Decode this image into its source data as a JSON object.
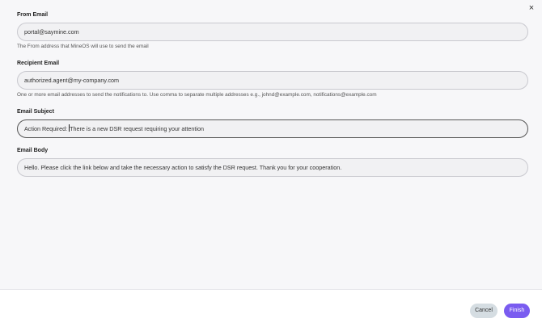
{
  "dialog": {
    "close_icon": "×"
  },
  "from_email": {
    "label": "From Email",
    "value": "portal@saymine.com",
    "help": "The From address that MineOS will use to send the email"
  },
  "recipient_email": {
    "label": "Recipient Email",
    "value": "authorized.agent@my-company.com",
    "help": "One or more email addresses to send the notifications to. Use comma to separate multiple addresses e.g., johnd@example.com, notifications@example.com"
  },
  "email_subject": {
    "label": "Email Subject",
    "value_before_caret": "Action Required: ",
    "value_after_caret": "There is a new DSR request requiring your attention"
  },
  "email_body": {
    "label": "Email Body",
    "value": "Hello.  Please click the link below and take the necessary action to satisfy the DSR request. Thank you for your cooperation."
  },
  "footer": {
    "cancel_label": "Cancel",
    "finish_label": "Finish"
  },
  "colors": {
    "accent": "#7a5cf0",
    "cancel_bg": "#d5dde2",
    "panel_bg": "#f7f7f9"
  }
}
